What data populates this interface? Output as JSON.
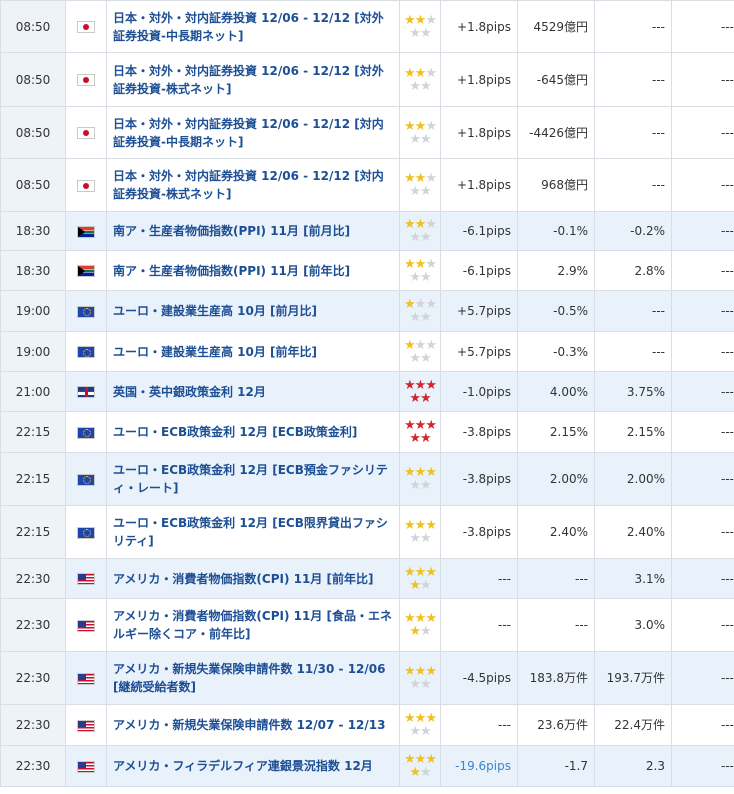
{
  "rows": [
    {
      "time": "08:50",
      "country": "jp",
      "name": "日本・対外・対内証券投資 12/06 - 12/12 [対外証券投資-中長期ネット]",
      "stars": 2,
      "red": false,
      "pips": "+1.8pips",
      "prev": "4529億円",
      "fcst": "---",
      "actual": "---"
    },
    {
      "time": "08:50",
      "country": "jp",
      "name": "日本・対外・対内証券投資 12/06 - 12/12 [対外証券投資-株式ネット]",
      "stars": 2,
      "red": false,
      "pips": "+1.8pips",
      "prev": "-645億円",
      "fcst": "---",
      "actual": "---"
    },
    {
      "time": "08:50",
      "country": "jp",
      "name": "日本・対外・対内証券投資 12/06 - 12/12 [対内証券投資-中長期ネット]",
      "stars": 2,
      "red": false,
      "pips": "+1.8pips",
      "prev": "-4426億円",
      "fcst": "---",
      "actual": "---"
    },
    {
      "time": "08:50",
      "country": "jp",
      "name": "日本・対外・対内証券投資 12/06 - 12/12 [対内証券投資-株式ネット]",
      "stars": 2,
      "red": false,
      "pips": "+1.8pips",
      "prev": "968億円",
      "fcst": "---",
      "actual": "---"
    },
    {
      "time": "18:30",
      "country": "za",
      "name": "南ア・生産者物価指数(PPI) 11月 [前月比]",
      "stars": 2,
      "red": false,
      "pips": "-6.1pips",
      "prev": "-0.1%",
      "fcst": "-0.2%",
      "actual": "---"
    },
    {
      "time": "18:30",
      "country": "za",
      "name": "南ア・生産者物価指数(PPI) 11月 [前年比]",
      "stars": 2,
      "red": false,
      "pips": "-6.1pips",
      "prev": "2.9%",
      "fcst": "2.8%",
      "actual": "---"
    },
    {
      "time": "19:00",
      "country": "eu",
      "name": "ユーロ・建設業生産高 10月 [前月比]",
      "stars": 1,
      "red": false,
      "pips": "+5.7pips",
      "prev": "-0.5%",
      "fcst": "---",
      "actual": "---"
    },
    {
      "time": "19:00",
      "country": "eu",
      "name": "ユーロ・建設業生産高 10月 [前年比]",
      "stars": 1,
      "red": false,
      "pips": "+5.7pips",
      "prev": "-0.3%",
      "fcst": "---",
      "actual": "---"
    },
    {
      "time": "21:00",
      "country": "gb",
      "name": "英国・英中銀政策金利 12月",
      "stars": 5,
      "red": true,
      "pips": "-1.0pips",
      "prev": "4.00%",
      "fcst": "3.75%",
      "actual": "---"
    },
    {
      "time": "22:15",
      "country": "eu",
      "name": "ユーロ・ECB政策金利 12月 [ECB政策金利]",
      "stars": 5,
      "red": true,
      "pips": "-3.8pips",
      "prev": "2.15%",
      "fcst": "2.15%",
      "actual": "---"
    },
    {
      "time": "22:15",
      "country": "eu",
      "name": "ユーロ・ECB政策金利 12月 [ECB預金ファシリティ・レート]",
      "stars": 3,
      "red": false,
      "pips": "-3.8pips",
      "prev": "2.00%",
      "fcst": "2.00%",
      "actual": "---"
    },
    {
      "time": "22:15",
      "country": "eu",
      "name": "ユーロ・ECB政策金利 12月 [ECB限界貸出ファシリティ]",
      "stars": 3,
      "red": false,
      "pips": "-3.8pips",
      "prev": "2.40%",
      "fcst": "2.40%",
      "actual": "---"
    },
    {
      "time": "22:30",
      "country": "us",
      "name": "アメリカ・消費者物価指数(CPI) 11月 [前年比]",
      "stars": 4,
      "red": false,
      "pips": "---",
      "prev": "---",
      "fcst": "3.1%",
      "actual": "---"
    },
    {
      "time": "22:30",
      "country": "us",
      "name": "アメリカ・消費者物価指数(CPI) 11月 [食品・エネルギー除くコア・前年比]",
      "stars": 4,
      "red": false,
      "pips": "---",
      "prev": "---",
      "fcst": "3.0%",
      "actual": "---"
    },
    {
      "time": "22:30",
      "country": "us",
      "name": "アメリカ・新規失業保険申請件数 11/30 - 12/06 [継続受給者数]",
      "stars": 3,
      "red": false,
      "pips": "-4.5pips",
      "prev": "183.8万件",
      "fcst": "193.7万件",
      "actual": "---"
    },
    {
      "time": "22:30",
      "country": "us",
      "name": "アメリカ・新規失業保険申請件数 12/07 - 12/13",
      "stars": 3,
      "red": false,
      "pips": "---",
      "prev": "23.6万件",
      "fcst": "22.4万件",
      "actual": "---"
    },
    {
      "time": "22:30",
      "country": "us",
      "name": "アメリカ・フィラデルフィア連銀景況指数 12月",
      "stars": 4,
      "red": false,
      "pips": "-19.6pips",
      "prev": "-1.7",
      "fcst": "2.3",
      "actual": "---",
      "pips_blue": true
    }
  ],
  "colors": {
    "star_on": "#f0c11e",
    "star_off": "#d0d4d9",
    "star_red": "#d4252f",
    "link": "#1d4f95",
    "shade": "#e9f1fb"
  }
}
